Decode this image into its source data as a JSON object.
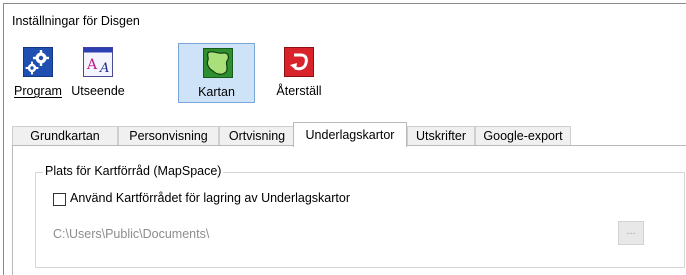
{
  "window": {
    "title": "Inställningar för Disgen"
  },
  "toolbar": {
    "buttons": [
      {
        "label": "Program",
        "icon": "gears-icon"
      },
      {
        "label": "Utseende",
        "icon": "font-appearance-icon"
      },
      {
        "label": "Kartan",
        "icon": "map-icon",
        "active": true
      },
      {
        "label": "Återställ",
        "icon": "reset-icon"
      }
    ]
  },
  "tabs": [
    {
      "label": "Grundkartan"
    },
    {
      "label": "Personvisning"
    },
    {
      "label": "Ortvisning"
    },
    {
      "label": "Underlagskartor",
      "active": true
    },
    {
      "label": "Utskrifter"
    },
    {
      "label": "Google-export"
    }
  ],
  "panel": {
    "group_title": "Plats för Kartförråd (MapSpace)",
    "checkbox_label": "Använd Kartförrådet för lagring av Underlagskartor",
    "checkbox_checked": false,
    "path": "C:\\Users\\Public\\Documents\\",
    "browse_label": "..."
  },
  "colors": {
    "active_button_bg": "#cfe3f8",
    "active_button_border": "#7aa6d8",
    "disabled_text": "#8d8d8d"
  }
}
